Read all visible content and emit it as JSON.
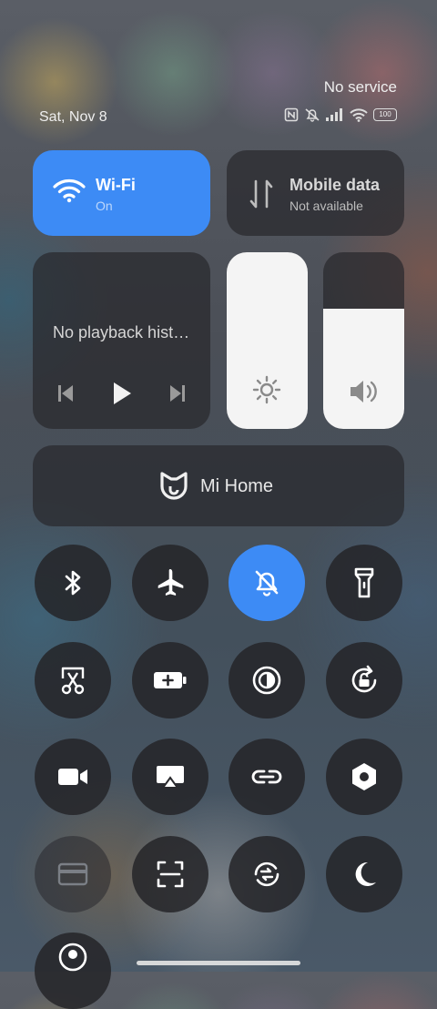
{
  "status_bar": {
    "carrier_status": "No service",
    "date": "Sat, Nov 8",
    "battery_level": "100",
    "icons": [
      "nfc-icon",
      "mute-icon",
      "signal-icon",
      "wifi-icon",
      "battery-icon"
    ]
  },
  "tiles": {
    "wifi": {
      "title": "Wi-Fi",
      "status": "On",
      "active": true,
      "color": "#3d8bf5"
    },
    "mobile_data": {
      "title": "Mobile data",
      "status": "Not available",
      "active": false
    }
  },
  "media": {
    "text": "No playback hist…"
  },
  "sliders": {
    "brightness": {
      "level_percent": 100
    },
    "volume": {
      "level_percent": 68
    }
  },
  "mi_home": {
    "label": "Mi Home"
  },
  "toggles": [
    {
      "name": "bluetooth",
      "icon": "bluetooth-icon",
      "active": false
    },
    {
      "name": "airplane-mode",
      "icon": "airplane-icon",
      "active": false
    },
    {
      "name": "silent-mode",
      "icon": "bell-off-icon",
      "active": true
    },
    {
      "name": "flashlight",
      "icon": "flashlight-icon",
      "active": false
    },
    {
      "name": "screenshot",
      "icon": "scissors-icon",
      "active": false
    },
    {
      "name": "battery-saver",
      "icon": "battery-plus-icon",
      "active": false
    },
    {
      "name": "reading-mode",
      "icon": "contrast-icon",
      "active": false
    },
    {
      "name": "auto-rotate",
      "icon": "rotate-lock-icon",
      "active": false
    },
    {
      "name": "screen-recorder",
      "icon": "video-camera-icon",
      "active": false
    },
    {
      "name": "cast",
      "icon": "cast-icon",
      "active": false
    },
    {
      "name": "link",
      "icon": "link-icon",
      "active": false
    },
    {
      "name": "settings",
      "icon": "hexagon-gear-icon",
      "active": false
    },
    {
      "name": "card",
      "icon": "card-icon",
      "active": false
    },
    {
      "name": "scanner",
      "icon": "scan-icon",
      "active": false
    },
    {
      "name": "sync",
      "icon": "sync-icon",
      "active": false
    },
    {
      "name": "dark-mode",
      "icon": "moon-icon",
      "active": false
    },
    {
      "name": "location",
      "icon": "location-icon",
      "active": false
    }
  ],
  "accent_color": "#3d8bf5"
}
